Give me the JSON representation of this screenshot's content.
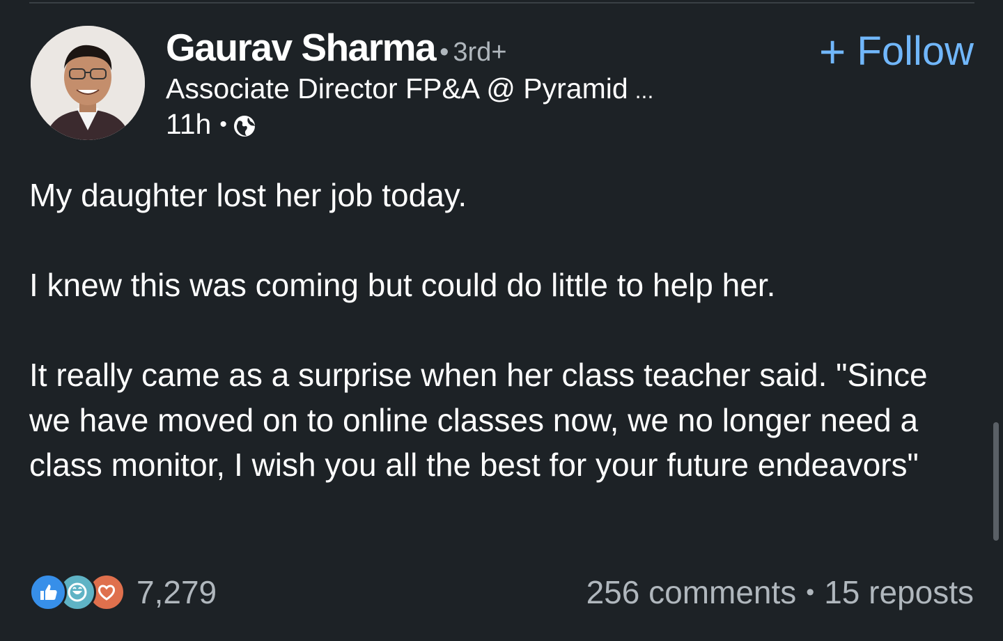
{
  "author": {
    "name": "Gaurav Sharma",
    "connection_degree": "3rd+",
    "headline": "Associate Director FP&A @ Pyramid",
    "headline_ellipsis": "...",
    "time_posted": "11h",
    "visibility_icon": "globe-icon"
  },
  "follow_button": {
    "icon": "plus-icon",
    "label": "Follow"
  },
  "post": {
    "paragraphs": [
      "My daughter lost her job today.",
      "I knew this was coming but could do little to help her.",
      "It really came as a surprise when her class teacher said. \"Since we have moved on to online classes now, we no longer need a class monitor, I wish you all the best for your future endeavors\""
    ]
  },
  "social": {
    "reaction_icons": [
      "like-icon",
      "celebrate-icon",
      "love-icon"
    ],
    "reaction_count": "7,279",
    "comments": "256 comments",
    "reposts": "15 reposts"
  },
  "colors": {
    "background": "#1d2226",
    "text": "#ffffff",
    "muted_text": "#b0b7bd",
    "follow_blue": "#71b7fb",
    "like_blue": "#378fe9",
    "celebrate_teal": "#5fb3c5",
    "love_orange": "#df704d"
  }
}
